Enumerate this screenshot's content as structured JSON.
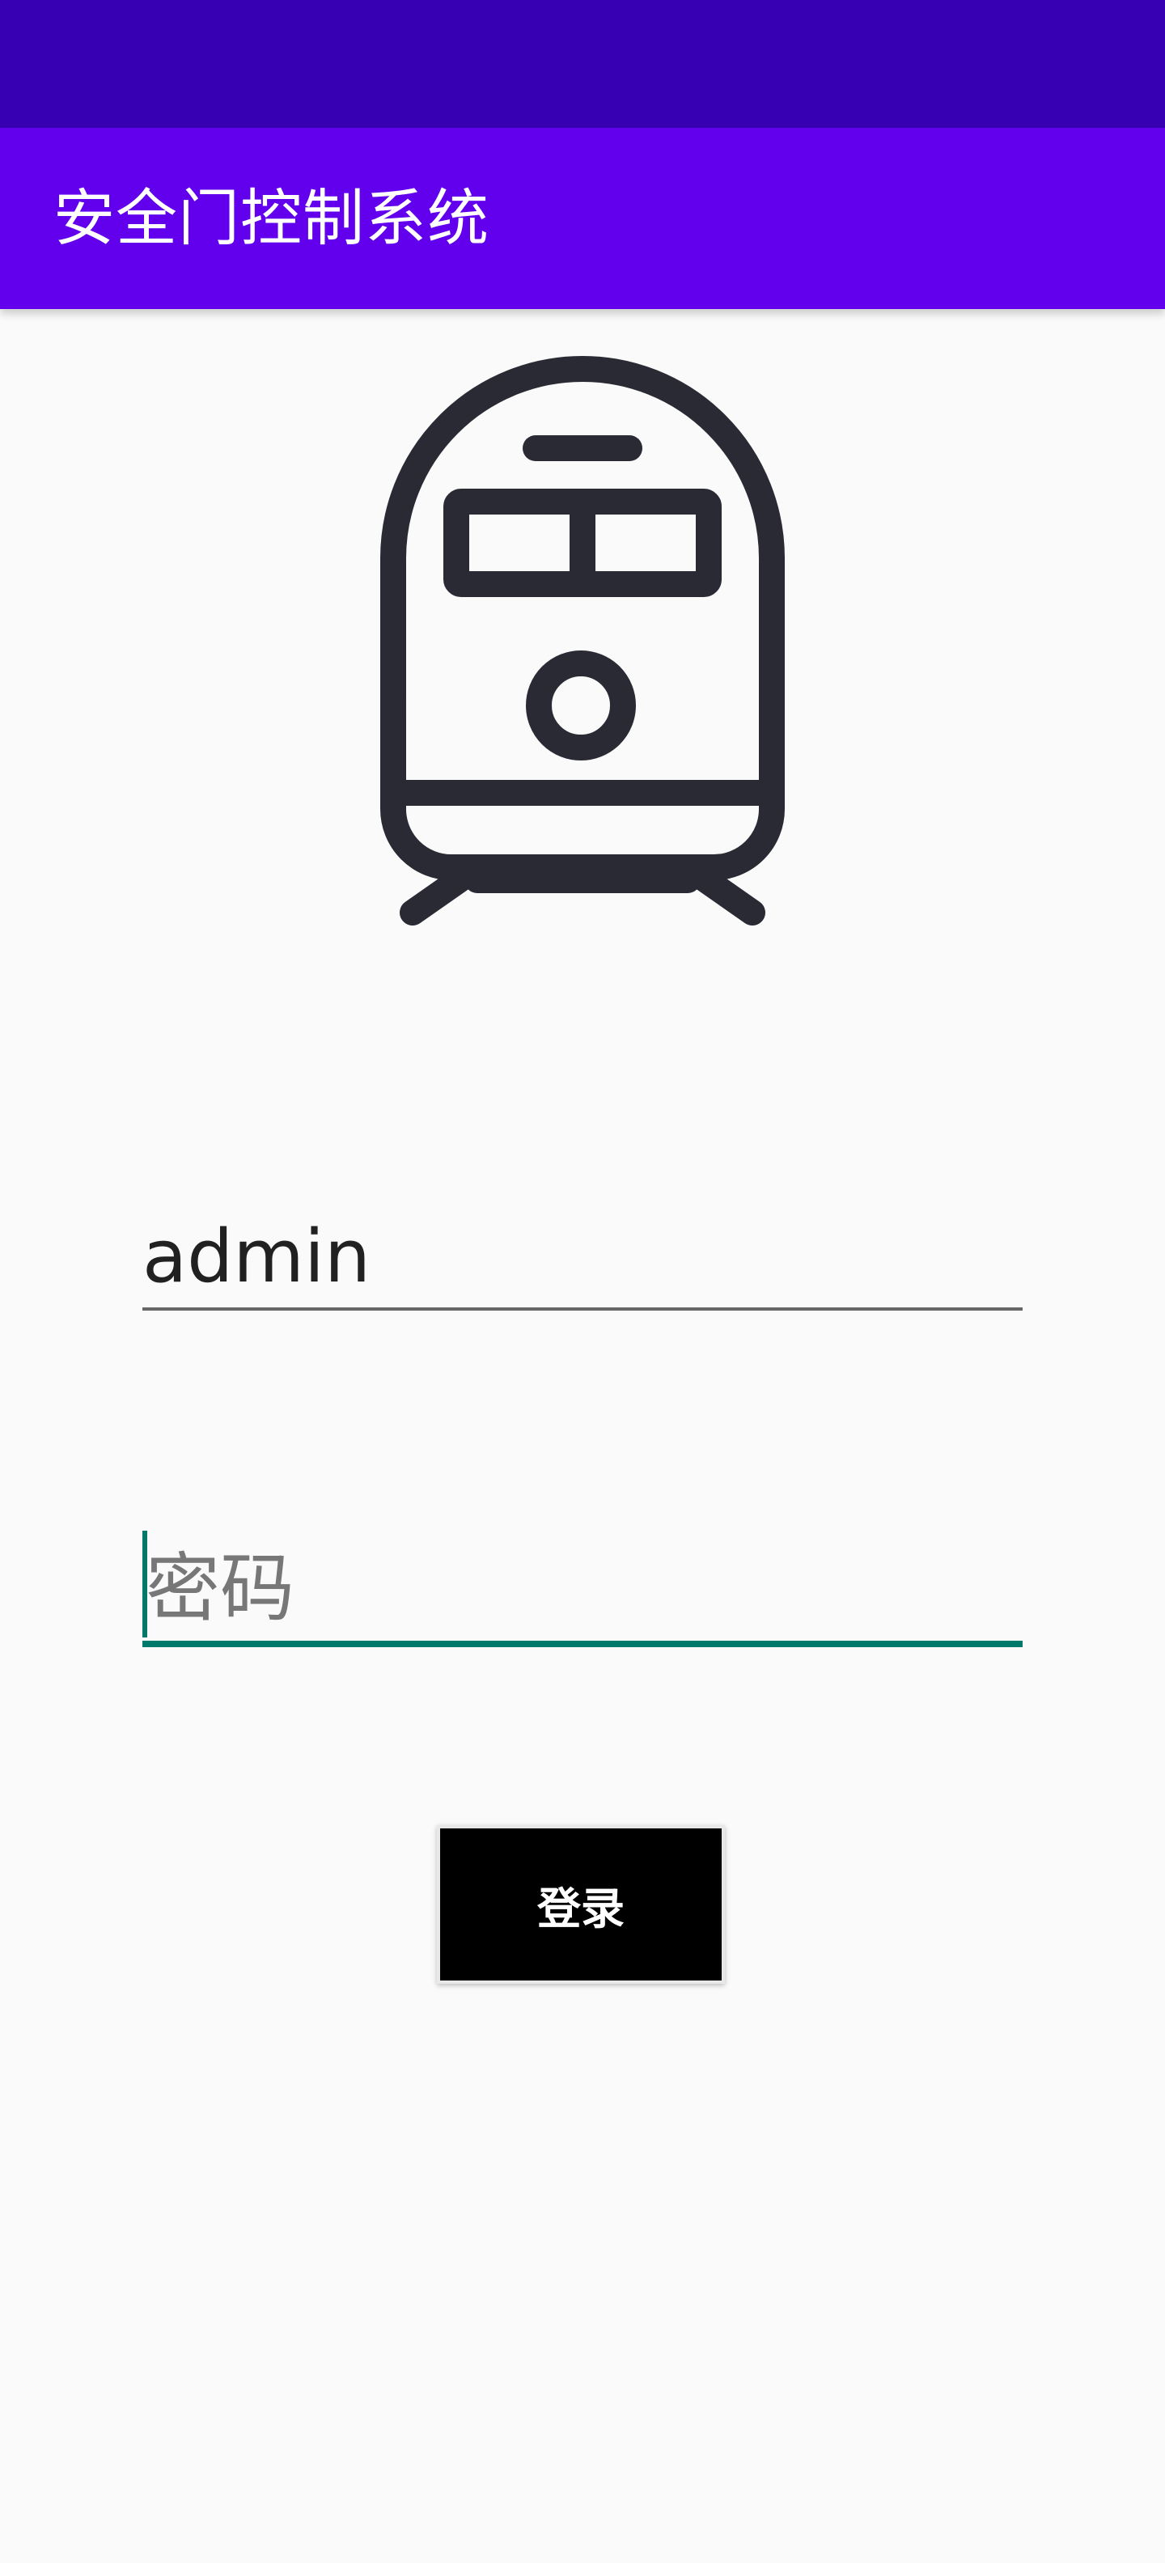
{
  "app_bar": {
    "title": "安全门控制系统"
  },
  "logo": {
    "icon": "train-icon",
    "color": "#2a2a35"
  },
  "login_form": {
    "username_value": "admin",
    "password_placeholder": "密码",
    "login_label": "登录"
  },
  "colors": {
    "status_bar": "#3700b3",
    "app_bar": "#6200ee",
    "accent": "#00796b",
    "button": "#000000"
  }
}
